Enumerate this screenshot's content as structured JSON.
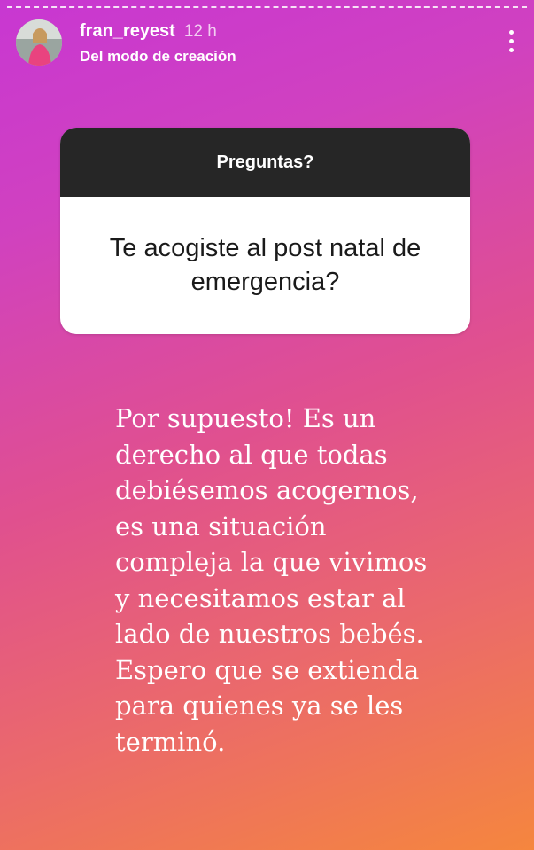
{
  "story": {
    "username": "fran_reyest",
    "time": "12 h",
    "subtitle": "Del modo de creación",
    "more_icon": "more-vertical-icon"
  },
  "question_sticker": {
    "header": "Preguntas?",
    "question": "Te acogiste al post natal de emergencia?"
  },
  "answer_lines": [
    "Por supuesto! Es un",
    "derecho al que todas",
    "debiésemos acogernos,",
    "es una situación",
    "compleja la que vivimos",
    "y necesitamos estar al",
    "lado de nuestros bebés.",
    "Espero que se extienda",
    "para quienes ya se les",
    "terminó."
  ]
}
